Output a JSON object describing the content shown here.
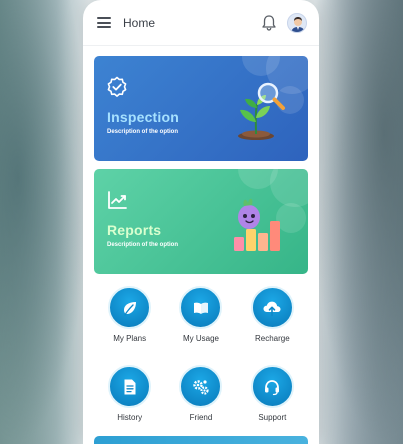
{
  "header": {
    "title": "Home",
    "menu_icon": "hamburger-menu-icon",
    "notification_icon": "bell-icon",
    "avatar_icon": "user-avatar"
  },
  "cards": [
    {
      "title": "Inspection",
      "description": "Description of the option",
      "icon": "badge-check-icon",
      "illustration": "plant-magnifier-illustration",
      "background": "#3672c8",
      "title_color": "#a6e1ff"
    },
    {
      "title": "Reports",
      "description": "Description of the option",
      "icon": "trend-chart-icon",
      "illustration": "bars-character-illustration",
      "background": "#48c497",
      "title_color": "#d9ffcf"
    }
  ],
  "grid": [
    {
      "label": "My Plans",
      "icon": "leaf-icon"
    },
    {
      "label": "My Usage",
      "icon": "open-book-icon"
    },
    {
      "label": "Recharge",
      "icon": "cloud-upload-icon"
    },
    {
      "label": "History",
      "icon": "document-list-icon"
    },
    {
      "label": "Friend",
      "icon": "gears-icon"
    },
    {
      "label": "Support",
      "icon": "headset-icon"
    }
  ],
  "colors": {
    "accent_blue": "#0e87c7",
    "page_background": "#ffffff",
    "text_primary": "#33373d"
  }
}
